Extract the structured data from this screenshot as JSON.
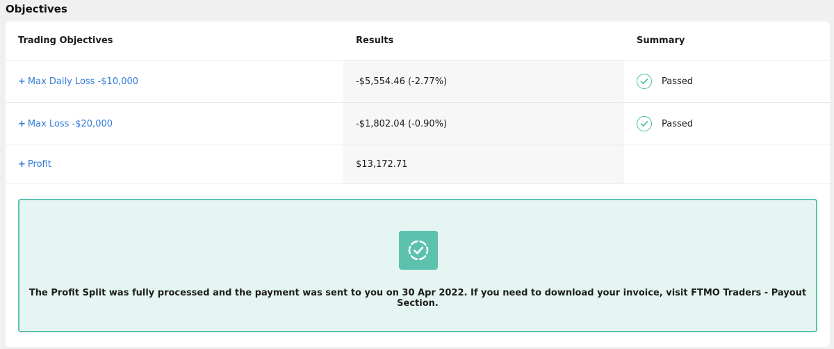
{
  "section": {
    "title": "Objectives"
  },
  "table": {
    "headers": [
      "Trading Objectives",
      "Results",
      "Summary"
    ],
    "rows": [
      {
        "objective": "Max Daily Loss -$10,000",
        "result": "-$5,554.46 (-2.77%)",
        "summary": "Passed",
        "summary_icon": "check-circle-icon"
      },
      {
        "objective": "Max Loss -$20,000",
        "result": "-$1,802.04 (-0.90%)",
        "summary": "Passed",
        "summary_icon": "check-circle-icon"
      },
      {
        "objective": "Profit",
        "result": "$13,172.71",
        "summary": ""
      }
    ],
    "expand_symbol": "+"
  },
  "notice": {
    "icon": "badge-check-icon",
    "message": "The Profit Split was fully processed and the payment was sent to you on 30 Apr 2022. If you need to download your invoice, visit FTMO Traders - Payout Section."
  },
  "colors": {
    "accent_teal": "#5cc2ad",
    "notice_bg": "#e5f5f1",
    "link_blue": "#2f7bd8",
    "check_green": "#3fbf9f"
  }
}
